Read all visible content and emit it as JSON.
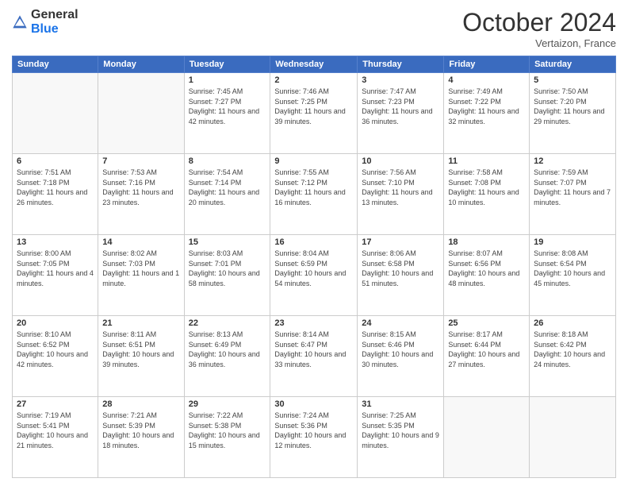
{
  "logo": {
    "text_general": "General",
    "text_blue": "Blue"
  },
  "header": {
    "month": "October 2024",
    "location": "Vertaizon, France"
  },
  "days_of_week": [
    "Sunday",
    "Monday",
    "Tuesday",
    "Wednesday",
    "Thursday",
    "Friday",
    "Saturday"
  ],
  "weeks": [
    [
      {
        "day": "",
        "info": ""
      },
      {
        "day": "",
        "info": ""
      },
      {
        "day": "1",
        "info": "Sunrise: 7:45 AM\nSunset: 7:27 PM\nDaylight: 11 hours and 42 minutes."
      },
      {
        "day": "2",
        "info": "Sunrise: 7:46 AM\nSunset: 7:25 PM\nDaylight: 11 hours and 39 minutes."
      },
      {
        "day": "3",
        "info": "Sunrise: 7:47 AM\nSunset: 7:23 PM\nDaylight: 11 hours and 36 minutes."
      },
      {
        "day": "4",
        "info": "Sunrise: 7:49 AM\nSunset: 7:22 PM\nDaylight: 11 hours and 32 minutes."
      },
      {
        "day": "5",
        "info": "Sunrise: 7:50 AM\nSunset: 7:20 PM\nDaylight: 11 hours and 29 minutes."
      }
    ],
    [
      {
        "day": "6",
        "info": "Sunrise: 7:51 AM\nSunset: 7:18 PM\nDaylight: 11 hours and 26 minutes."
      },
      {
        "day": "7",
        "info": "Sunrise: 7:53 AM\nSunset: 7:16 PM\nDaylight: 11 hours and 23 minutes."
      },
      {
        "day": "8",
        "info": "Sunrise: 7:54 AM\nSunset: 7:14 PM\nDaylight: 11 hours and 20 minutes."
      },
      {
        "day": "9",
        "info": "Sunrise: 7:55 AM\nSunset: 7:12 PM\nDaylight: 11 hours and 16 minutes."
      },
      {
        "day": "10",
        "info": "Sunrise: 7:56 AM\nSunset: 7:10 PM\nDaylight: 11 hours and 13 minutes."
      },
      {
        "day": "11",
        "info": "Sunrise: 7:58 AM\nSunset: 7:08 PM\nDaylight: 11 hours and 10 minutes."
      },
      {
        "day": "12",
        "info": "Sunrise: 7:59 AM\nSunset: 7:07 PM\nDaylight: 11 hours and 7 minutes."
      }
    ],
    [
      {
        "day": "13",
        "info": "Sunrise: 8:00 AM\nSunset: 7:05 PM\nDaylight: 11 hours and 4 minutes."
      },
      {
        "day": "14",
        "info": "Sunrise: 8:02 AM\nSunset: 7:03 PM\nDaylight: 11 hours and 1 minute."
      },
      {
        "day": "15",
        "info": "Sunrise: 8:03 AM\nSunset: 7:01 PM\nDaylight: 10 hours and 58 minutes."
      },
      {
        "day": "16",
        "info": "Sunrise: 8:04 AM\nSunset: 6:59 PM\nDaylight: 10 hours and 54 minutes."
      },
      {
        "day": "17",
        "info": "Sunrise: 8:06 AM\nSunset: 6:58 PM\nDaylight: 10 hours and 51 minutes."
      },
      {
        "day": "18",
        "info": "Sunrise: 8:07 AM\nSunset: 6:56 PM\nDaylight: 10 hours and 48 minutes."
      },
      {
        "day": "19",
        "info": "Sunrise: 8:08 AM\nSunset: 6:54 PM\nDaylight: 10 hours and 45 minutes."
      }
    ],
    [
      {
        "day": "20",
        "info": "Sunrise: 8:10 AM\nSunset: 6:52 PM\nDaylight: 10 hours and 42 minutes."
      },
      {
        "day": "21",
        "info": "Sunrise: 8:11 AM\nSunset: 6:51 PM\nDaylight: 10 hours and 39 minutes."
      },
      {
        "day": "22",
        "info": "Sunrise: 8:13 AM\nSunset: 6:49 PM\nDaylight: 10 hours and 36 minutes."
      },
      {
        "day": "23",
        "info": "Sunrise: 8:14 AM\nSunset: 6:47 PM\nDaylight: 10 hours and 33 minutes."
      },
      {
        "day": "24",
        "info": "Sunrise: 8:15 AM\nSunset: 6:46 PM\nDaylight: 10 hours and 30 minutes."
      },
      {
        "day": "25",
        "info": "Sunrise: 8:17 AM\nSunset: 6:44 PM\nDaylight: 10 hours and 27 minutes."
      },
      {
        "day": "26",
        "info": "Sunrise: 8:18 AM\nSunset: 6:42 PM\nDaylight: 10 hours and 24 minutes."
      }
    ],
    [
      {
        "day": "27",
        "info": "Sunrise: 7:19 AM\nSunset: 5:41 PM\nDaylight: 10 hours and 21 minutes."
      },
      {
        "day": "28",
        "info": "Sunrise: 7:21 AM\nSunset: 5:39 PM\nDaylight: 10 hours and 18 minutes."
      },
      {
        "day": "29",
        "info": "Sunrise: 7:22 AM\nSunset: 5:38 PM\nDaylight: 10 hours and 15 minutes."
      },
      {
        "day": "30",
        "info": "Sunrise: 7:24 AM\nSunset: 5:36 PM\nDaylight: 10 hours and 12 minutes."
      },
      {
        "day": "31",
        "info": "Sunrise: 7:25 AM\nSunset: 5:35 PM\nDaylight: 10 hours and 9 minutes."
      },
      {
        "day": "",
        "info": ""
      },
      {
        "day": "",
        "info": ""
      }
    ]
  ]
}
